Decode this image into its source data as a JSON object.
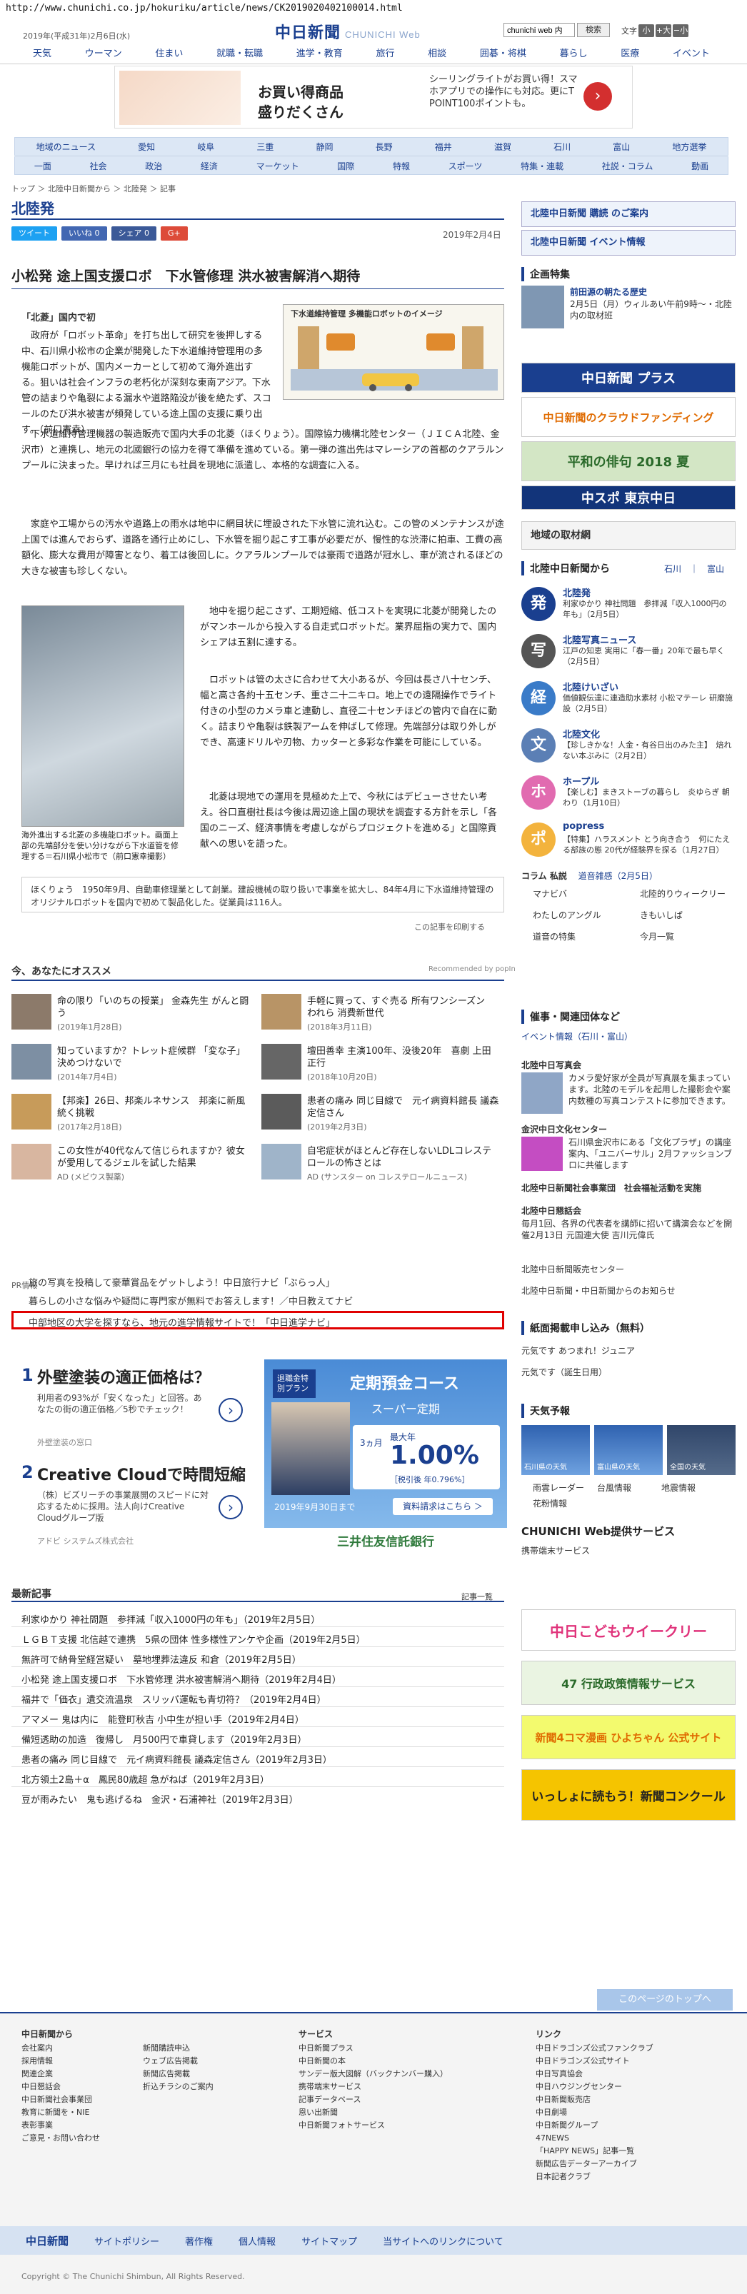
{
  "url": "http://www.chunichi.co.jp/hokuriku/article/news/CK2019020402100014.html",
  "header": {
    "date": "2019年(平成31年)2月6日(水)",
    "logo": "中日新聞",
    "logo_sub": "CHUNICHI Web",
    "search_value": "chunichi web 内",
    "search_button": "検索",
    "font_label": "文字",
    "font_small": "小",
    "font_plus": "+大",
    "font_minus": "−小",
    "nav": [
      "天気",
      "ウーマン",
      "住まい",
      "就職・転職",
      "進学・教育",
      "旅行",
      "相談",
      "囲碁・将棋",
      "暮らし",
      "医療",
      "イベント"
    ]
  },
  "ad_top": {
    "line1": "お買い得商品",
    "line2": "盛りだくさん",
    "desc": "シーリングライトがお買い得！スマホアプリでの操作にも対応。更にT POINT100ポイントも。",
    "go": "›"
  },
  "subnav": {
    "row1": [
      "地域のニュース",
      "愛知",
      "岐阜",
      "三重",
      "静岡",
      "長野",
      "福井",
      "滋賀",
      "石川",
      "富山",
      "地方選挙"
    ],
    "row2": [
      "一面",
      "社会",
      "政治",
      "経済",
      "マーケット",
      "国際",
      "特報",
      "スポーツ",
      "特集・連載",
      "社説・コラム",
      "動画"
    ]
  },
  "breadcrumb": "トップ ＞ 北陸中日新聞から ＞ 北陸発 ＞ 記事",
  "section_title": "北陸発",
  "share": {
    "tweet": "ツイート",
    "like": "いいね 0",
    "share": "シェア 0",
    "gplus": "G+"
  },
  "article": {
    "date": "2019年2月4日",
    "title": "小松発 途上国支援ロボ　下水管修理 洪水被害解消へ期待",
    "byline": "「北菱」国内で初",
    "p1": "政府が「ロボット革命」を打ち出して研究を後押しする中、石川県小松市の企業が開発した下水道維持管理用の多機能ロボットが、国内メーカーとして初めて海外進出する。狙いは社会インフラの老朽化が深刻な東南アジア。下水管の詰まりや亀裂による漏水や道路陥没が後を絶たず、スコールのたび洪水被害が頻発している途上国の支援に乗り出す。（前口憲幸）",
    "p2": "下水道維持管理機器の製造販売で国内大手の北菱（ほくりょう）。国際協力機構北陸センター（ＪＩＣＡ北陸、金沢市）と連携し、地元の北國銀行の協力を得て準備を進めている。第一弾の進出先はマレーシアの首都のクアラルンプールに決まった。早ければ三月にも社員を現地に派遣し、本格的な調査に入る。",
    "p3": "家庭や工場からの汚水や道路上の雨水は地中に網目状に埋設された下水管に流れ込む。この管のメンテナンスが途上国では進んでおらず、道路を通行止めにし、下水管を掘り起こす工事が必要だが、慢性的な渋滞に拍車、工費の高額化、膨大な費用が障害となり、着工は後回しに。クアラルンプールでは豪雨で道路が冠水し、車が流されるほどの大きな被害も珍しくない。",
    "p4": "地中を掘り起こさず、工期短縮、低コストを実現に北菱が開発したのがマンホールから投入する自走式ロボットだ。業界屈指の実力で、国内シェアは五割に達する。",
    "p5": "ロボットは管の太さに合わせて大小あるが、今回は長さ八十センチ、幅と高さ各約十五センチ、重さ二十二キロ。地上での遠隔操作でライト付きの小型のカメラ車と連動し、直径二十センチほどの管内で自在に動く。詰まりや亀裂は鉄製アームを伸ばして修理。先端部分は取り外しができ、高速ドリルや刃物、カッターと多彩な作業を可能にしている。",
    "p6": "北菱は現地での運用を見極めた上で、今秋にはデビューさせたい考え。谷口直樹社長は今後は周辺途上国の現状を調査する方針を示し「各国のニーズ、経済事情を考慮しながらプロジェクトを進める」と国際貢献への思いを語った。",
    "fig1_caption": "下水道維持管理 多機能ロボットのイメージ",
    "fig2_caption": "海外進出する北菱の多機能ロボット。画面上部の先端部分を使い分けながら下水道管を修理する＝石川県小松市で（前口憲幸撮影）",
    "profile": "ほくりょう　1950年9月、自動車修理業として創業。建設機械の取り扱いで事業を拡大し、84年4月に下水道維持管理のオリジナルロボットを国内で初めて製品化した。従業員は116人。",
    "print": "この記事を印刷する"
  },
  "recommend": {
    "title": "今、あなたにオススメ",
    "by": "Recommended by popIn",
    "items": [
      {
        "text": "命の限り「いのちの授業」 金森先生 がんと闘う",
        "sub": "(2019年1月28日)"
      },
      {
        "text": "手軽に買って、すぐ売る 所有ワンシーズン　われら 消費新世代",
        "sub": "(2018年3月11日)"
      },
      {
        "text": "知っていますか？トレット症候群 「変な子」決めつけないで",
        "sub": "(2014年7月4日)"
      },
      {
        "text": "壇田善幸 主演100年、没後20年　喜劇 上田正行",
        "sub": "(2018年10月20日)"
      },
      {
        "text": "【邦楽】26日、邦楽ルネサンス　邦楽に新風　統く挑戦",
        "sub": "(2017年2月18日)"
      },
      {
        "text": "患者の痛み 同じ目線で　元イ病資料館長 議森定信さん",
        "sub": "(2019年2月3日)"
      },
      {
        "text": "この女性が40代なんて信じられますか？彼女が愛用してるジェルを試した結果",
        "sub": "AD (メビウス製薬)"
      },
      {
        "text": "自宅症状がほとんど存在しないLDLコレステロールの怖さとは",
        "sub": "AD (サンスター on コレステロールニュース)"
      }
    ]
  },
  "pr": {
    "label": "PR情報",
    "items": [
      "旅の写真を投稿して豪華賞品をゲットしよう！中日旅行ナビ「ぶらっ人」",
      "暮らしの小さな悩みや疑問に専門家が無料でお答えします！／中日教えてナビ",
      "中部地区の大学を探すなら、地元の進学情報サイトで！「中日進学ナビ」"
    ]
  },
  "lower_ads": {
    "a1_title": "外壁塗装の適正価格は？",
    "a1_desc": "利用者の93%が「安くなった」と回答。あなたの街の適正価格／5秒でチェック！",
    "a1_src": "外壁塗装の窓口",
    "a2_title": "Creative Cloudで時間短縮",
    "a2_desc": "（株）ビズリーチの事業展開のスピードに対応するために採用。法人向けCreative Cloudグループ版",
    "a2_src": "アドビ システムズ株式会社",
    "num1": "1",
    "num2": "2",
    "arrow": "›"
  },
  "bank_ad": {
    "tag": "退職金特別プラン",
    "head": "定期預金コース",
    "plan": "スーパー定期",
    "term": "3ヵ月",
    "max": "最大年",
    "rate": "1.00%",
    "tax": "［税引後 年0.796%］",
    "until": "2019年9月30日まで",
    "cta": "資料請求はこちら ＞",
    "bank": "三井住友信託銀行"
  },
  "latest": {
    "title": "最新記事",
    "more": "記事一覧",
    "items": [
      "利家ゆかり 神社問題　参拝減「収入1000円の年も」（2019年2月5日）",
      "ＬＧＢＴ支援 北信越で連携　5県の団体 性多様性アンケや企画（2019年2月5日）",
      "無許可で納骨堂経営疑い　墓地埋葬法違反 和倉（2019年2月5日）",
      "小松発 途上国支援ロボ　下水管修理 洪水被害解消へ期待（2019年2月4日）",
      "福井で「価衣」遺交流温泉　スリッパ運転も青切符？（2019年2月4日）",
      "アマメー 鬼は内に　能登町秋吉 小中生が担い手（2019年2月4日）",
      "備短透助の加造　復帰し　月500円で車貸します（2019年2月3日）",
      "患者の痛み 同じ目線で　元イ病資料館長 議森定信さん（2019年2月3日）",
      "北方領土2島＋α　鳳民80歳超 急がねば（2019年2月3日）",
      "豆が雨みたい　鬼も逃げるね　金沢・石浦神社（2019年2月3日）"
    ]
  },
  "right": {
    "sub_btn": "北陸中日新聞 購読 のご案内",
    "event_btn": "北陸中日新聞 イベント情報",
    "kikaku_head": "企画特集",
    "kikaku_title": "前田源の朝たる歴史",
    "kikaku_desc": "2月5日（月）ウィルあい午前9時〜・北陸内の取材班",
    "bnr1": "中日新聞 プラス",
    "bnr2": "中日新聞のクラウドファンディング",
    "bnr3": "平和の俳句 2018 夏",
    "bnr4": "中スポ 東京中日",
    "local_head": "地域の取材網",
    "from_head": "北陸中日新聞から",
    "from_links": "石川　｜　富山",
    "news": [
      {
        "icon": "発",
        "title": "北陸発",
        "desc": "利家ゆかり 神社問題　参拝減「収入1000円の年も」（2月5日）",
        "color": "#1a3f8f"
      },
      {
        "icon": "写",
        "title": "北陸写真ニュース",
        "desc": "江戸の知恵 実用に「春一番」20年で最も早く（2月5日）",
        "color": "#555555"
      },
      {
        "icon": "経",
        "title": "北陸けいざい",
        "desc": "価値観伝達に連造助水素材 小松マテーレ 研磨施設（2月5日）",
        "color": "#3a7bc8"
      },
      {
        "icon": "文",
        "title": "北陸文化",
        "desc": "【珍しきかな！人金・有谷日出のみた主】　焙れない本ぶみに（2月2日）",
        "color": "#5b7fb5"
      },
      {
        "icon": "ホ",
        "title": "ホープル",
        "desc": "【楽しむ】まきストーブの暮らし　炎ゆらぎ 朝わり（1月10日）",
        "color": "#e16bb0"
      },
      {
        "icon": "ポ",
        "title": "popress",
        "desc": "【特集】ハラスメント とう向き合う　何にたえる部族の態 20代が経験界を探る（1月27日）",
        "color": "#f3b33d"
      }
    ],
    "column_head": "コラム 私説",
    "column_date": "道音雑感（2月5日）",
    "mini_links": [
      "マナビバ",
      "北陸的りウィークリー",
      "わたしのアングル",
      "きもいしぱ",
      "道音の特集",
      "今月一覧"
    ],
    "event_head": "催事・関連団体など",
    "event_sub": "イベント情報（石川・富山）",
    "e1_title": "北陸中日写真会",
    "e1_desc": "カメラ愛好家が全員が写真展を集まっています。北陸のモデルを起用した撮影会や案内数種の写真コンテストに参加できます。",
    "e2_title": "金沢中日文化センター",
    "e2_desc": "石川県金沢市にある「文化プラザ」の講座案内、「ユニバーサル」2月ファッションブロに共催します",
    "e3_title": "北陸中日新聞社会事業団　社会福祉活動を実施",
    "e4_title": "北陸中日懇話会",
    "e4_desc": "毎月1回、各界の代表者を講師に招いて講演会などを開催2月13日 元国連大使 吉川元偉氏",
    "e5": "北陸中日新聞販売センター",
    "e6": "北陸中日新聞・中日新聞からのお知らせ",
    "koukoku_head": "紙面掲載申し込み（無料）",
    "k1": "元気です あつまれ！ジュニア",
    "k2": "元気です（誕生日用）",
    "k2_note": "誕生日用",
    "weather_head": "天気予報",
    "weather": [
      "石川県の天気",
      "富山県の天気",
      "全国の天気"
    ],
    "radar": [
      "雨雲レーダー",
      "台風情報",
      "地震情報",
      "花粉情報"
    ],
    "web_head": "CHUNICHI Web提供サービス",
    "web_sub": "携帯端末サービス",
    "b_kodomo": "中日こどもウイークリー",
    "b_gyosei": "47 行政政策情報サービス",
    "b_yonkoma": "新聞4コマ漫画 ひよちゃん 公式サイト",
    "b_nie": "いっしょに読もう！新聞コンクール"
  },
  "footer": {
    "back_top": "このページのトップへ",
    "col1_head": "中日新聞から",
    "col1": [
      "会社案内",
      "採用情報",
      "関連企業",
      "中日懇話会",
      "中日新聞社会事業団",
      "教育に新聞を・NIE",
      "表彰事業",
      "ご意見・お問い合わせ"
    ],
    "col2": [
      "新聞購読申込",
      "ウェブ広告掲載",
      "新聞広告掲載",
      "折込チラシのご案内"
    ],
    "col3_head": "サービス",
    "col3": [
      "中日新聞プラス",
      "中日新聞の本",
      "サンデー版大図解（バックナンバー購入）",
      "携帯端末サービス",
      "記事データベース",
      "恩い出新聞",
      "中日新聞フォトサービス"
    ],
    "col4_head": "リンク",
    "col4": [
      "中日ドラゴンズ公式ファンクラブ",
      "中日ドラゴンズ公式サイト",
      "中日写真協会",
      "中日ハウジングセンター",
      "中日新聞販売店",
      "中日劇場",
      "中日新聞グループ",
      "47NEWS",
      "「HAPPY NEWS」記事一覧",
      "新聞広告データーアーカイブ",
      "日本記者クラブ"
    ],
    "bar": [
      "中日新聞",
      "サイトポリシー",
      "著作権",
      "個人情報",
      "サイトマップ",
      "当サイトへのリンクについて"
    ],
    "copyright": "Copyright © The Chunichi Shimbun, All Rights Reserved."
  }
}
